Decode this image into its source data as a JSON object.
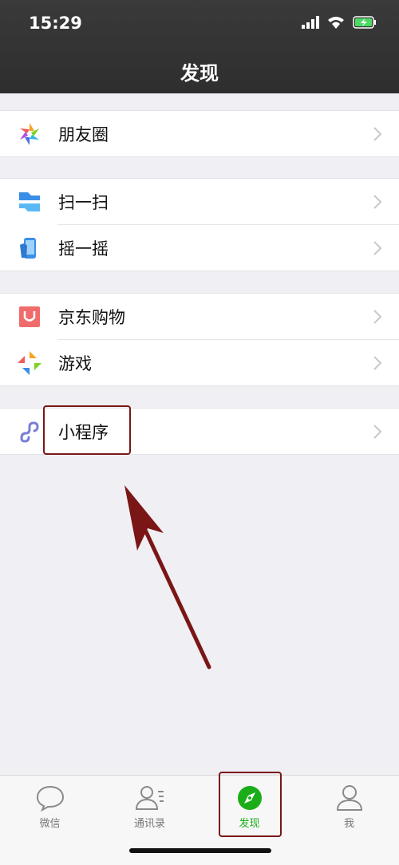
{
  "status": {
    "time": "15:29"
  },
  "header": {
    "title": "发现"
  },
  "groups": [
    [
      {
        "label": "朋友圈",
        "icon": "moments-icon"
      }
    ],
    [
      {
        "label": "扫一扫",
        "icon": "scan-icon"
      },
      {
        "label": "摇一摇",
        "icon": "shake-icon"
      }
    ],
    [
      {
        "label": "京东购物",
        "icon": "jd-shopping-icon"
      },
      {
        "label": "游戏",
        "icon": "games-icon"
      }
    ],
    [
      {
        "label": "小程序",
        "icon": "mini-program-icon"
      }
    ]
  ],
  "tabbar": {
    "tabs": [
      {
        "label": "微信",
        "icon": "chat-bubble-icon"
      },
      {
        "label": "通讯录",
        "icon": "contacts-icon"
      },
      {
        "label": "发现",
        "icon": "compass-icon",
        "active": true
      },
      {
        "label": "我",
        "icon": "person-icon"
      }
    ]
  },
  "colors": {
    "accent": "#1aad19",
    "annotation": "#7a1616",
    "header_bg": "#2e2e2e"
  }
}
